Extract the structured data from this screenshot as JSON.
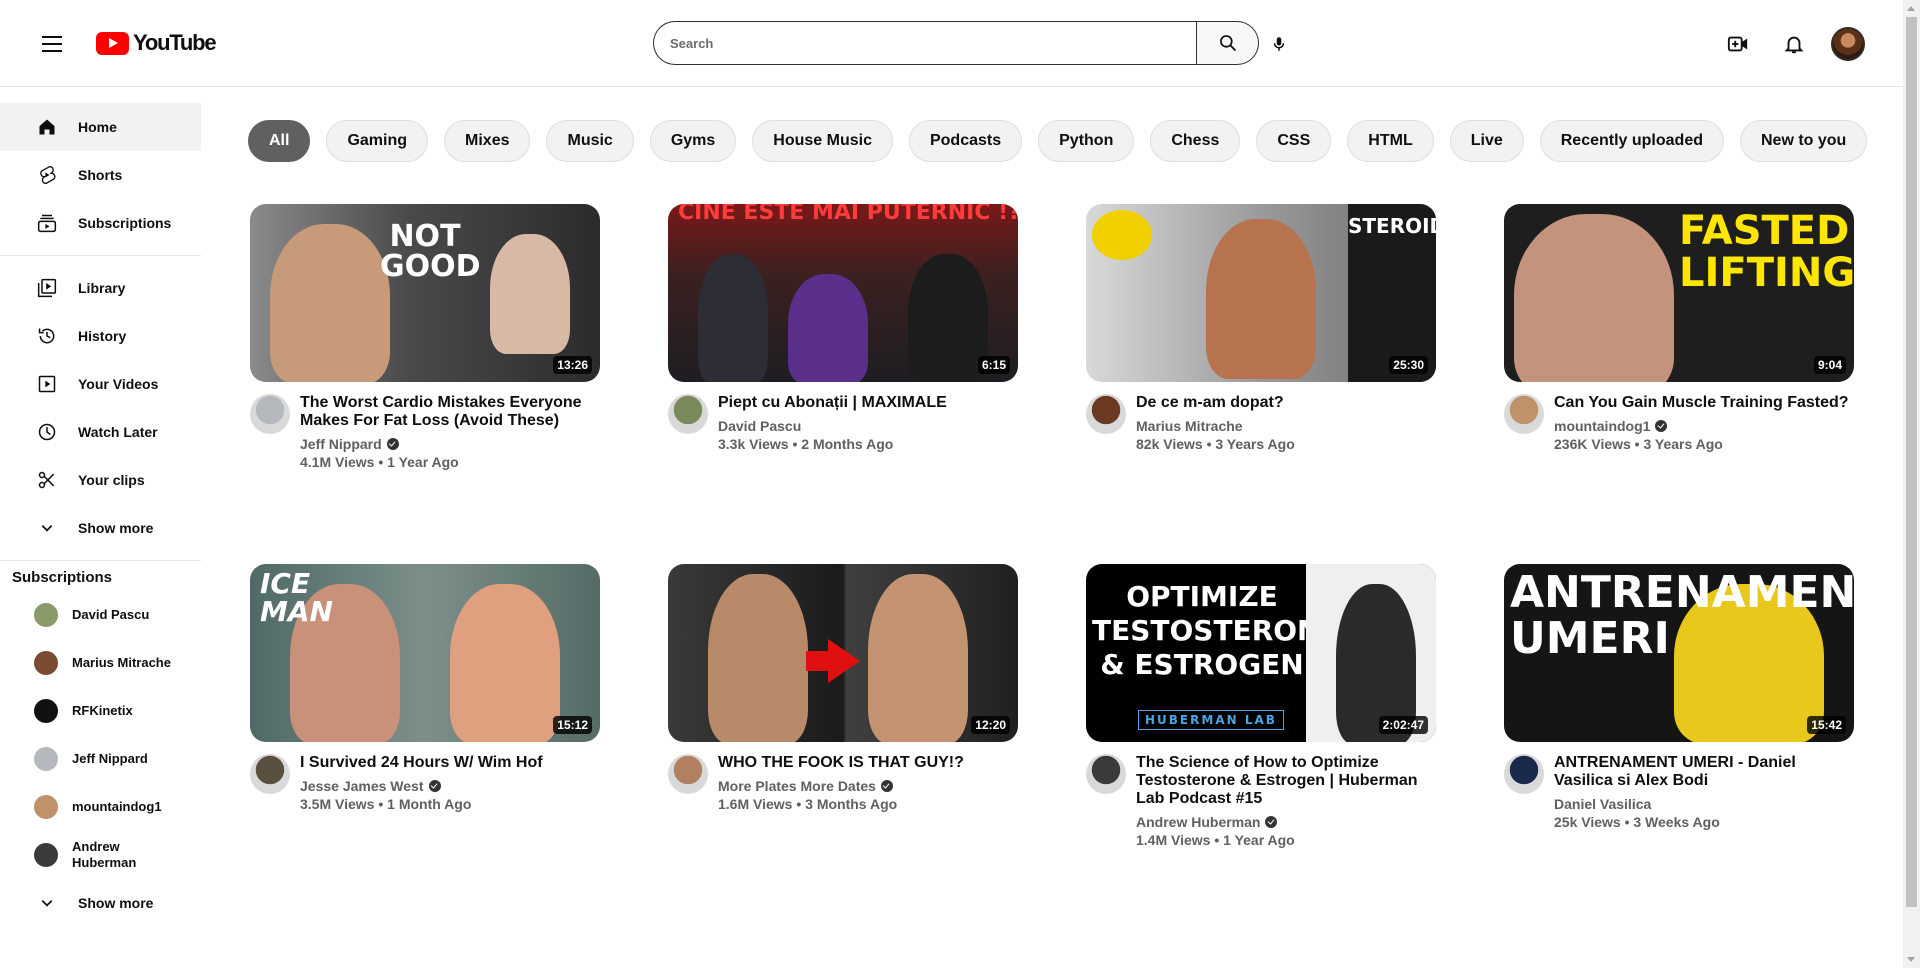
{
  "header": {
    "logo_text": "YouTube",
    "search_placeholder": "Search"
  },
  "sidebar": {
    "primary": [
      {
        "label": "Home",
        "icon": "home-icon",
        "active": true
      },
      {
        "label": "Shorts",
        "icon": "shorts-icon"
      },
      {
        "label": "Subscriptions",
        "icon": "subscriptions-icon"
      }
    ],
    "secondary": [
      {
        "label": "Library",
        "icon": "library-icon"
      },
      {
        "label": "History",
        "icon": "history-icon"
      },
      {
        "label": "Your Videos",
        "icon": "your-videos-icon"
      },
      {
        "label": "Watch Later",
        "icon": "watch-later-icon"
      },
      {
        "label": "Your clips",
        "icon": "scissors-icon"
      },
      {
        "label": "Show more",
        "icon": "chevron-down-icon"
      }
    ],
    "subscriptions_heading": "Subscriptions",
    "subscriptions": [
      {
        "name": "David Pascu",
        "color": "#8a9a6a"
      },
      {
        "name": "Marius Mitrache",
        "color": "#7a4a32"
      },
      {
        "name": "RFKinetix",
        "color": "#111111"
      },
      {
        "name": "Jeff Nippard",
        "color": "#b5b8bd"
      },
      {
        "name": "mountaindog1",
        "color": "#c0926a"
      },
      {
        "name": "Andrew Huberman",
        "color": "#3a3a3a"
      }
    ],
    "subscriptions_show_more": "Show more"
  },
  "chips": [
    "All",
    "Gaming",
    "Mixes",
    "Music",
    "Gyms",
    "House Music",
    "Podcasts",
    "Python",
    "Chess",
    "CSS",
    "HTML",
    "Live",
    "Recently uploaded",
    "New to you"
  ],
  "videos": [
    {
      "title": "The Worst Cardio Mistakes Everyone Makes For Fat Loss (Avoid These)",
      "channel": "Jeff Nippard",
      "verified": true,
      "views": "4.1M Views",
      "age": "1 Year Ago",
      "duration": "13:26",
      "thumb_text": "NOT GOOD"
    },
    {
      "title": "Piept cu Abonații | MAXIMALE",
      "channel": "David Pascu",
      "verified": false,
      "views": "3.3k Views",
      "age": "2 Months Ago",
      "duration": "6:15",
      "thumb_text": "CINE ESTE MAI PUTERNIC !?"
    },
    {
      "title": "De ce m-am dopat?",
      "channel": "Marius Mitrache",
      "verified": false,
      "views": "82k Views",
      "age": "3 Years Ago",
      "duration": "25:30",
      "thumb_text": "STEROIDS"
    },
    {
      "title": "Can You Gain Muscle Training Fasted?",
      "channel": "mountaindog1",
      "verified": true,
      "views": "236K Views",
      "age": "3 Years Ago",
      "duration": "9:04",
      "thumb_text": "FASTED LIFTING"
    },
    {
      "title": "I Survived 24 Hours W/ Wim Hof",
      "channel": "Jesse James West",
      "verified": true,
      "views": "3.5M Views",
      "age": "1 Month Ago",
      "duration": "15:12",
      "thumb_text": "ICE MAN"
    },
    {
      "title": "WHO THE FOOK IS THAT GUY!?",
      "channel": "More Plates More Dates",
      "verified": true,
      "views": "1.6M Views",
      "age": "3 Months Ago",
      "duration": "12:20",
      "thumb_text": ""
    },
    {
      "title": "The Science of How to Optimize Testosterone & Estrogen | Huberman Lab Podcast #15",
      "channel": "Andrew Huberman",
      "verified": true,
      "views": "1.4M Views",
      "age": "1 Year Ago",
      "duration": "2:02:47",
      "thumb_text": "OPTIMIZE TESTOSTERONE & ESTROGEN",
      "thumb_sub": "HUBERMAN LAB"
    },
    {
      "title": "ANTRENAMENT UMERI - Daniel Vasilica si Alex Bodi",
      "channel": "Daniel Vasilica",
      "verified": false,
      "views": "25k Views",
      "age": "3 Weeks Ago",
      "duration": "15:42",
      "thumb_text": "ANTRENAMENT UMERI"
    }
  ]
}
